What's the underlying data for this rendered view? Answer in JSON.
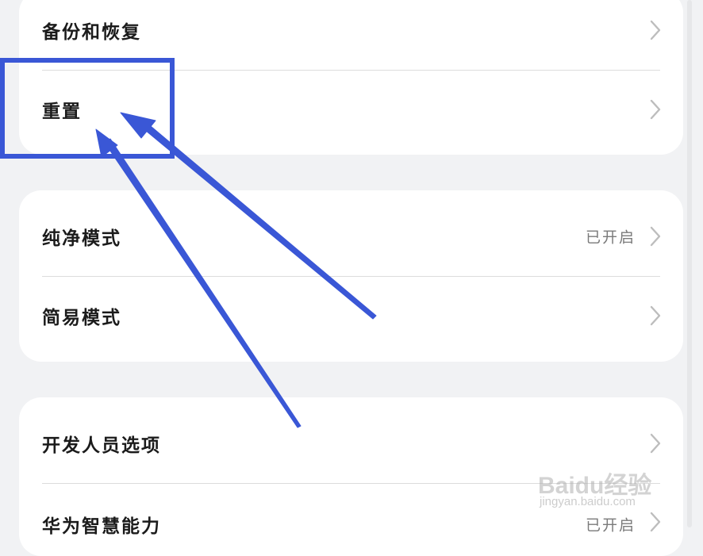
{
  "cards": [
    {
      "rows": [
        {
          "label": "备份和恢复",
          "status": ""
        },
        {
          "label": "重置",
          "status": ""
        }
      ]
    },
    {
      "rows": [
        {
          "label": "纯净模式",
          "status": "已开启"
        },
        {
          "label": "简易模式",
          "status": ""
        }
      ]
    },
    {
      "rows": [
        {
          "label": "开发人员选项",
          "status": ""
        },
        {
          "label": "华为智慧能力",
          "status": "已开启"
        }
      ]
    }
  ],
  "annotation": {
    "highlight_color": "#3a57d6",
    "arrow_color": "#3a57d6"
  },
  "icons": {
    "row_chevron": "chevron-right-icon"
  },
  "watermark": {
    "brand": "Baidu经验",
    "url": "jingyan.baidu.com"
  }
}
